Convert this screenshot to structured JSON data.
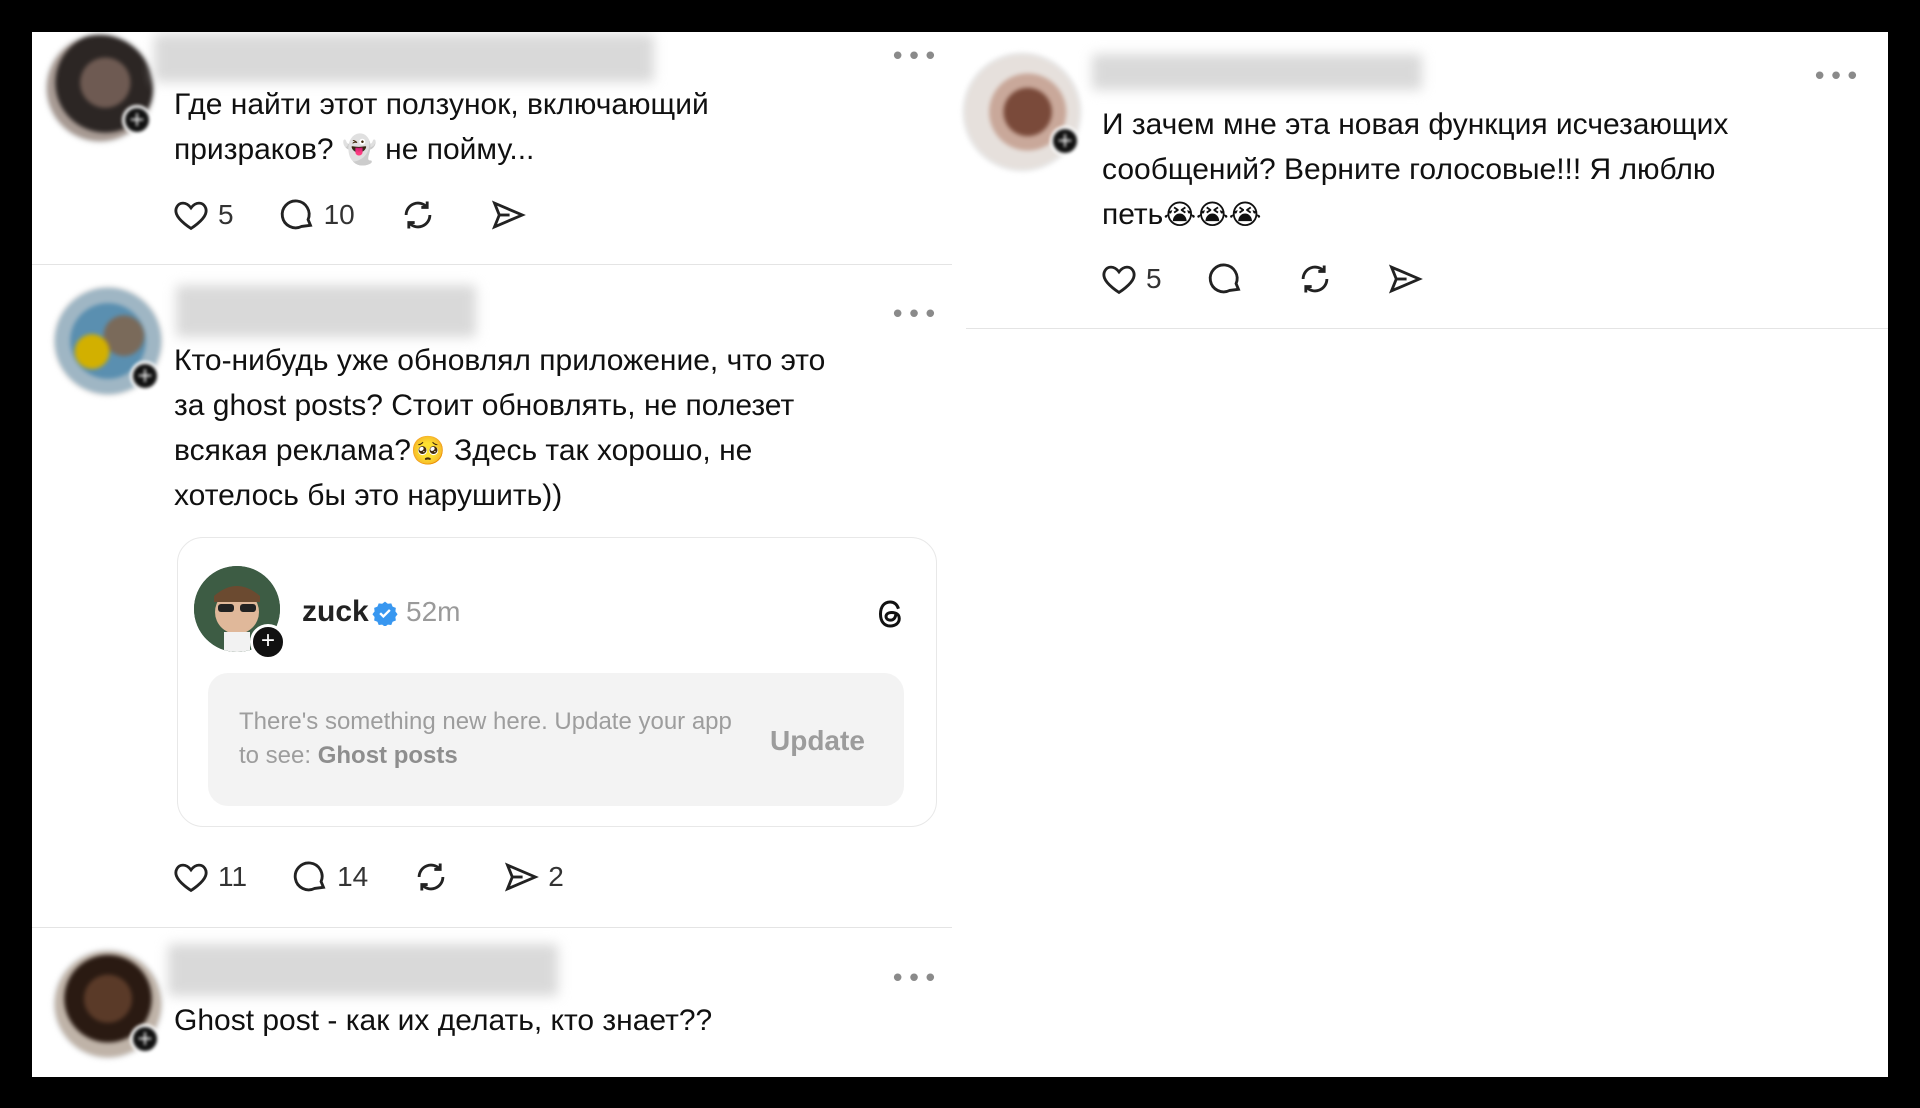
{
  "posts": [
    {
      "id": "post1",
      "text_parts": [
        "Где найти этот ползунок, включающий",
        "призраков?",
        "👻",
        "не пойму..."
      ],
      "likes": "5",
      "comments": "10",
      "reposts": "",
      "shares": ""
    },
    {
      "id": "post2",
      "text_lines": [
        "Кто-нибудь уже обновлял приложение, что это",
        "за ghost posts? Стоит обновлять, не полезет",
        "всякая реклама?",
        "🥺",
        "Здесь так хорошо, не",
        "хотелось бы это нарушить))"
      ],
      "likes": "11",
      "comments": "14",
      "reposts": "",
      "shares": "2",
      "quote": {
        "username": "zuck",
        "time": "52m",
        "message": "There's something new here. Update your app to see:",
        "feature": "Ghost posts",
        "button": "Update"
      }
    },
    {
      "id": "post3",
      "text": "Ghost post - как их делать, кто знает??"
    },
    {
      "id": "post4",
      "text_lines": [
        "И зачем мне эта новая функция исчезающих",
        "сообщений? Верните голосовые!!! Я люблю",
        "петь",
        "😭😭😭"
      ],
      "likes": "5",
      "comments": "",
      "reposts": "",
      "shares": ""
    }
  ],
  "icons": {
    "like": "heart-icon",
    "comment": "comment-bubble-icon",
    "repost": "repost-icon",
    "share": "send-icon",
    "more": "more-options-icon",
    "verified": "verified-badge-icon",
    "threads": "threads-logo-icon"
  },
  "ui": {
    "more_glyph": "•••",
    "plus_glyph": "+"
  },
  "colors": {
    "background": "#000000",
    "card": "#ffffff",
    "verified": "#3897f0",
    "muted": "#9a9a9a"
  }
}
